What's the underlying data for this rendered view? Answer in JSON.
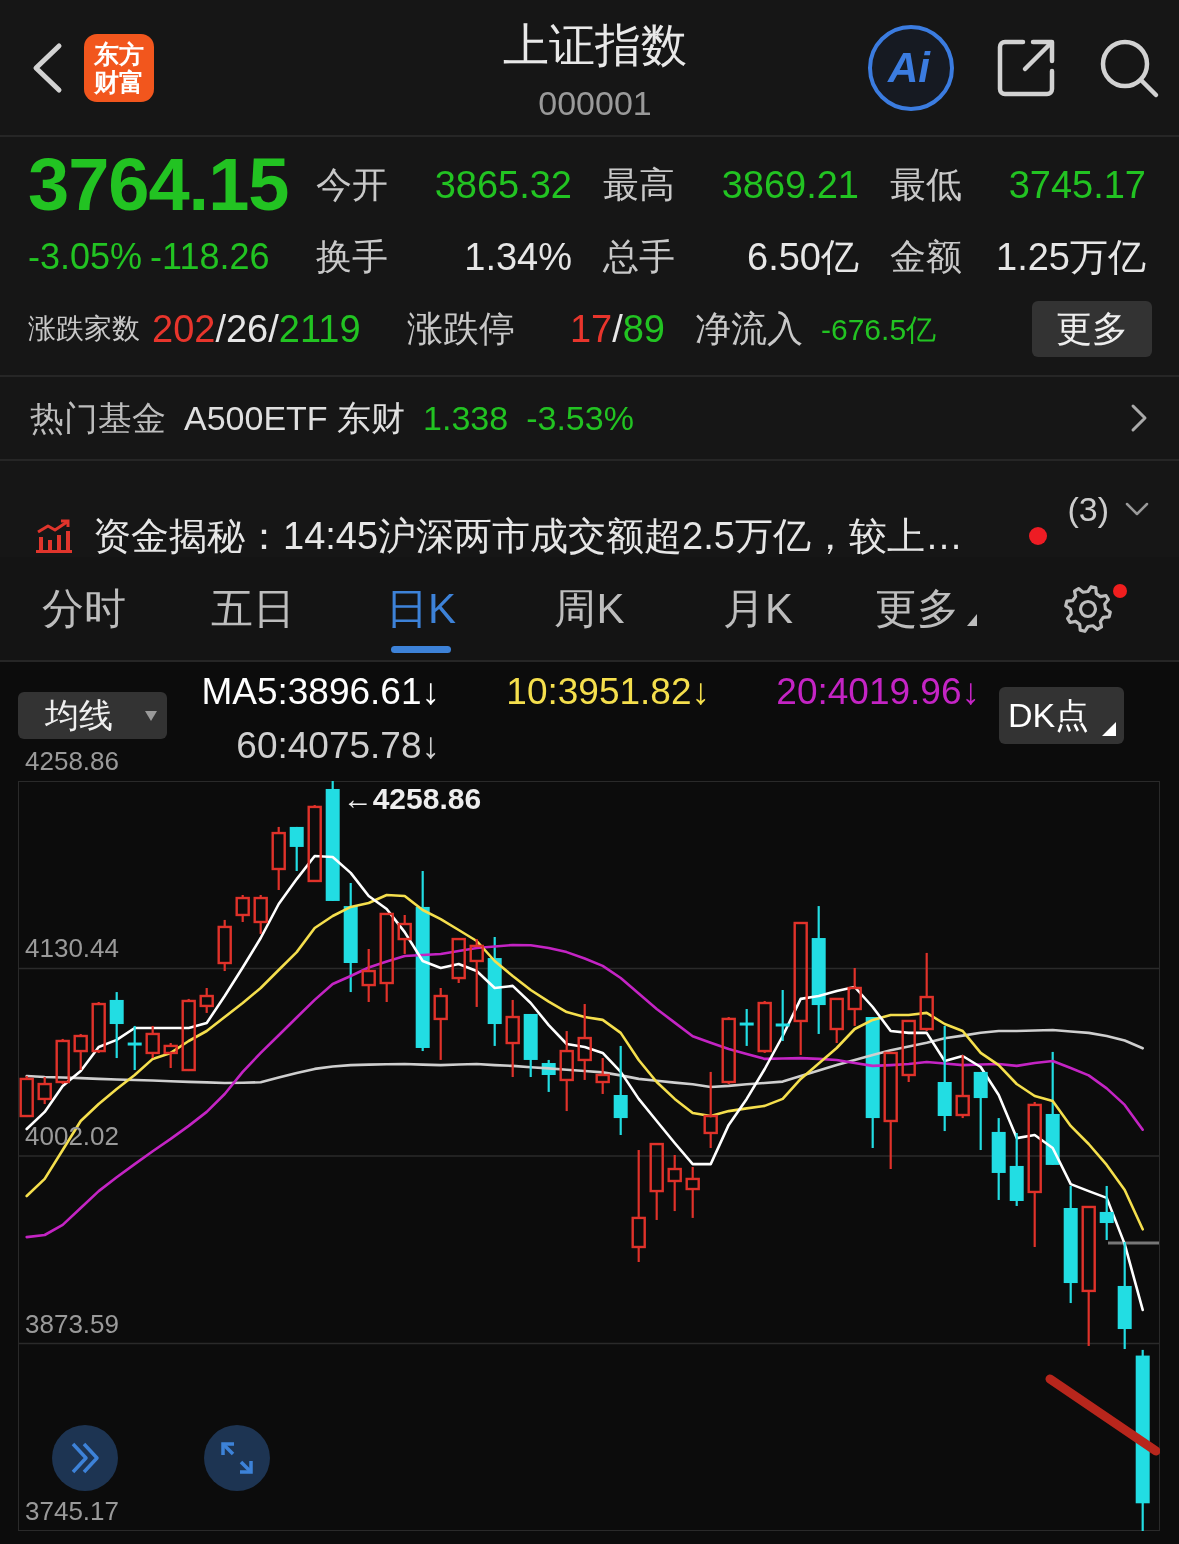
{
  "header": {
    "logo": "东方财富",
    "title": "上证指数",
    "code": "000001",
    "ai_button": "Ai"
  },
  "quote": {
    "price": "3764.15",
    "change_pct": "-3.05%",
    "change": "-118.26",
    "falling": true,
    "stats": [
      {
        "label": "今开",
        "value": "3865.32",
        "color": "#22c322"
      },
      {
        "label": "最高",
        "value": "3869.21",
        "color": "#22c322"
      },
      {
        "label": "最低",
        "value": "3745.17",
        "color": "#22c322"
      },
      {
        "label": "换手",
        "value": "1.34%",
        "color": "#e6e6e6"
      },
      {
        "label": "总手",
        "value": "6.50亿",
        "color": "#e6e6e6"
      },
      {
        "label": "金额",
        "value": "1.25万亿",
        "color": "#e6e6e6"
      }
    ],
    "breadth": {
      "label": "涨跌家数",
      "parts": [
        {
          "text": "202",
          "color": "#e8352c"
        },
        {
          "text": "/26/",
          "color": "#e6e6e6"
        },
        {
          "text": "2119",
          "color": "#22c322"
        }
      ]
    },
    "limits": {
      "label": "涨跌停",
      "parts": [
        {
          "text": "17",
          "color": "#e8352c"
        },
        {
          "text": "/",
          "color": "#e6e6e6"
        },
        {
          "text": "89",
          "color": "#22c322"
        }
      ]
    },
    "net_inflow": {
      "label": "净流入",
      "value": "-676.5亿",
      "falling": true
    },
    "more_button": "更多"
  },
  "hot_fund": {
    "label": "热门基金",
    "name": "A500ETF 东财",
    "price": "1.338",
    "change": "-3.53%",
    "falling": true
  },
  "news": {
    "text": "资金揭秘：14:45沪深两市成交额超2.5万亿，较上…",
    "unread": true,
    "count": "(3)"
  },
  "period_tabs": [
    {
      "label": "分时",
      "selected": false,
      "kind": "tab"
    },
    {
      "label": "五日",
      "selected": false,
      "kind": "tab"
    },
    {
      "label": "日K",
      "selected": true,
      "kind": "tab"
    },
    {
      "label": "周K",
      "selected": false,
      "kind": "tab"
    },
    {
      "label": "月K",
      "selected": false,
      "kind": "tab"
    },
    {
      "label": "更多",
      "selected": false,
      "kind": "menu"
    }
  ],
  "settings": {
    "badge": true
  },
  "indicators": {
    "dropdown": "均线",
    "dk_button": "DK点"
  },
  "chart": {
    "chart_data": {
      "type": "candlestick",
      "grid": true,
      "ylim": [
        3745.17,
        4258.86
      ],
      "yticks": [
        4258.86,
        4130.44,
        4002.02,
        3873.59,
        3745.17
      ],
      "ohlc": [
        [
          4029.4,
          4056.8,
          4028.7,
          4054.8
        ],
        [
          4041.1,
          4056.1,
          4037.6,
          4051.3
        ],
        [
          4052.7,
          4082.2,
          4051.3,
          4080.8
        ],
        [
          4073.9,
          4085.6,
          4060.9,
          4084.2
        ],
        [
          4073.9,
          4107.5,
          4072.6,
          4106.1
        ],
        [
          4108.9,
          4114.3,
          4069.1,
          4092.4
        ],
        [
          4079.4,
          4091.1,
          4060.9,
          4078.0
        ],
        [
          4072.6,
          4091.1,
          4069.1,
          4085.6
        ],
        [
          4072.6,
          4079.4,
          4062.3,
          4077.4
        ],
        [
          4060.9,
          4109.6,
          4060.2,
          4108.2
        ],
        [
          4104.8,
          4117.1,
          4100.0,
          4111.6
        ],
        [
          4134.2,
          4163.7,
          4128.7,
          4158.9
        ],
        [
          4167.1,
          4180.8,
          4162.3,
          4178.7
        ],
        [
          4162.3,
          4180.8,
          4154.1,
          4178.7
        ],
        [
          4198.6,
          4227.4,
          4184.2,
          4223.2
        ],
        [
          4227.4,
          4227.4,
          4197.2,
          4213.7
        ],
        [
          4190.4,
          4242.4,
          4189.7,
          4241.1
        ],
        [
          4253.4,
          4258.86,
          4176.7,
          4176.7
        ],
        [
          4173.2,
          4189.0,
          4114.3,
          4134.2
        ],
        [
          4119.1,
          4143.8,
          4107.5,
          4128.7
        ],
        [
          4120.5,
          4167.8,
          4107.5,
          4167.8
        ],
        [
          4150.6,
          4167.1,
          4140.4,
          4160.9
        ],
        [
          4172.6,
          4197.2,
          4073.9,
          4076.0
        ],
        [
          4095.9,
          4117.1,
          4067.8,
          4111.6
        ],
        [
          4123.9,
          4150.6,
          4120.5,
          4150.6
        ],
        [
          4135.6,
          4150.6,
          4104.1,
          4145.9
        ],
        [
          4137.6,
          4152.0,
          4077.4,
          4092.4
        ],
        [
          4079.4,
          4108.9,
          4056.1,
          4097.2
        ],
        [
          4099.3,
          4099.3,
          4056.1,
          4067.8
        ],
        [
          4065.7,
          4067.8,
          4045.9,
          4057.5
        ],
        [
          4054.1,
          4087.6,
          4032.8,
          4073.9
        ],
        [
          4067.8,
          4106.1,
          4054.1,
          4082.8
        ],
        [
          4052.7,
          4069.1,
          4044.5,
          4057.5
        ],
        [
          4043.8,
          4077.4,
          4016.4,
          4028.0
        ],
        [
          3939.7,
          4006.1,
          3929.4,
          3959.6
        ],
        [
          3978.0,
          4010.2,
          3958.2,
          4010.2
        ],
        [
          3984.9,
          4002.7,
          3964.3,
          3993.1
        ],
        [
          3979.4,
          3994.5,
          3959.6,
          3986.3
        ],
        [
          4017.8,
          4059.6,
          4007.5,
          4029.4
        ],
        [
          4052.7,
          4097.2,
          4051.3,
          4095.9
        ],
        [
          4093.1,
          4102.7,
          4077.4,
          4091.7
        ],
        [
          4073.9,
          4108.2,
          4072.6,
          4106.8
        ],
        [
          4092.4,
          4115.7,
          4080.8,
          4091.1
        ],
        [
          4094.5,
          4161.6,
          4071.2,
          4161.6
        ],
        [
          4151.3,
          4173.2,
          4085.6,
          4105.4
        ],
        [
          4089.0,
          4109.6,
          4079.4,
          4109.6
        ],
        [
          4102.7,
          4130.8,
          4091.1,
          4117.1
        ],
        [
          4097.2,
          4097.2,
          4007.5,
          4028.0
        ],
        [
          4026.0,
          4072.6,
          3993.1,
          4072.6
        ],
        [
          4057.5,
          4094.5,
          4052.7,
          4094.5
        ],
        [
          4089.0,
          4141.1,
          4087.6,
          4110.9
        ],
        [
          4052.7,
          4091.1,
          4019.1,
          4029.4
        ],
        [
          4030.1,
          4071.2,
          4028.0,
          4043.1
        ],
        [
          4059.6,
          4059.6,
          4006.1,
          4041.7
        ],
        [
          4018.5,
          4028.0,
          3971.9,
          3990.4
        ],
        [
          3995.2,
          4017.8,
          3967.8,
          3971.2
        ],
        [
          3977.4,
          4039.0,
          3939.7,
          4037.0
        ],
        [
          4030.8,
          4073.3,
          3995.9,
          3995.9
        ],
        [
          3966.4,
          3981.5,
          3901.3,
          3915.0
        ],
        [
          3909.6,
          3967.1,
          3871.9,
          3967.1
        ],
        [
          3963.7,
          3981.5,
          3944.5,
          3956.1
        ],
        [
          3913.0,
          3943.1,
          3869.8,
          3883.5
        ],
        [
          3865.32,
          3869.21,
          3745.17,
          3764.15
        ]
      ],
      "series": [
        {
          "name": "MA5:3896.61↓",
          "type": "line",
          "color": "#ffffff",
          "values": [
            4020.5,
            4032.2,
            4050.0,
            4060.2,
            4076.7,
            4081.5,
            4089.7,
            4089.7,
            4089.7,
            4089.7,
            4093.1,
            4111.6,
            4131.1,
            4151.3,
            4174.6,
            4191.7,
            4207.5,
            4206.8,
            4195.9,
            4180.1,
            4171.2,
            4155.4,
            4135.6,
            4130.8,
            4133.5,
            4128.7,
            4117.1,
            4118.5,
            4106.8,
            4091.7,
            4078.7,
            4076.7,
            4072.6,
            4059.6,
            4041.1,
            4026.0,
            4010.9,
            3996.5,
            3996.5,
            4023.3,
            4041.1,
            4061.6,
            4084.2,
            4109.6,
            4111.6,
            4115.0,
            4117.8,
            4104.1,
            4087.6,
            4086.3,
            4086.3,
            4067.1,
            4070.5,
            4063.0,
            4043.8,
            4014.3,
            4016.4,
            4007.5,
            3982.8,
            3978.0,
            3973.3,
            3941.7,
            3896.6
          ]
        },
        {
          "name": "10:3951.82↓",
          "type": "line",
          "color": "#f5df4d",
          "values": [
            3974.6,
            3986.3,
            4006.1,
            4026.0,
            4037.6,
            4047.9,
            4057.5,
            4068.5,
            4072.6,
            4080.8,
            4087.6,
            4097.2,
            4106.8,
            4117.1,
            4129.4,
            4141.7,
            4158.2,
            4166.4,
            4172.6,
            4175.3,
            4180.8,
            4180.1,
            4170.5,
            4164.3,
            4156.8,
            4149.3,
            4135.6,
            4125.3,
            4115.7,
            4107.8,
            4100.6,
            4097.2,
            4095.2,
            4086.3,
            4067.8,
            4052.7,
            4041.1,
            4031.5,
            4029.4,
            4032.8,
            4034.6,
            4036.3,
            4041.1,
            4054.8,
            4065.4,
            4076.0,
            4089.0,
            4095.2,
            4098.6,
            4098.6,
            4100.0,
            4092.4,
            4087.6,
            4072.6,
            4064.3,
            4051.3,
            4043.1,
            4039.7,
            4022.6,
            4010.2,
            3995.9,
            3978.7,
            3951.8
          ]
        },
        {
          "name": "20:4019.96↓",
          "type": "line",
          "color": "#c424c4",
          "values": [
            3946.5,
            3947.9,
            3954.8,
            3966.4,
            3978.0,
            3987.4,
            3996.5,
            4005.3,
            4013.7,
            4022.6,
            4032.2,
            4044.5,
            4059.6,
            4072.6,
            4084.7,
            4096.9,
            4108.9,
            4119.8,
            4125.3,
            4131.1,
            4135.3,
            4139.0,
            4139.7,
            4140.4,
            4142.4,
            4144.5,
            4145.5,
            4146.5,
            4146.3,
            4144.5,
            4141.7,
            4137.3,
            4132.2,
            4123.9,
            4113.3,
            4102.7,
            4093.4,
            4084.1,
            4079.6,
            4075.3,
            4071.9,
            4068.5,
            4068.8,
            4069.1,
            4068.5,
            4067.8,
            4065.7,
            4063.7,
            4064.3,
            4065.0,
            4066.4,
            4065.4,
            4064.3,
            4064.7,
            4065.0,
            4063.7,
            4065.7,
            4067.1,
            4062.3,
            4057.2,
            4048.3,
            4037.0,
            4020.0
          ]
        },
        {
          "name": "60:4075.78↓",
          "type": "line",
          "color": "#cfcfcf",
          "values": [
            4056.8,
            4056.1,
            4055.8,
            4055.4,
            4054.8,
            4054.4,
            4054.1,
            4053.7,
            4053.2,
            4052.8,
            4052.4,
            4052.0,
            4052.2,
            4052.5,
            4055.8,
            4058.9,
            4061.7,
            4063.3,
            4064.3,
            4064.6,
            4064.8,
            4065.0,
            4064.6,
            4064.3,
            4064.7,
            4065.0,
            4064.3,
            4063.7,
            4062.8,
            4062.0,
            4061.1,
            4060.2,
            4059.3,
            4057.2,
            4054.8,
            4053.5,
            4052.3,
            4051.1,
            4049.3,
            4050.0,
            4051.1,
            4052.0,
            4053.0,
            4056.8,
            4060.6,
            4064.3,
            4067.8,
            4071.2,
            4074.5,
            4077.0,
            4079.6,
            4082.7,
            4084.5,
            4086.4,
            4087.6,
            4087.6,
            4088.0,
            4088.3,
            4087.3,
            4086.3,
            4084.2,
            4081.1,
            4075.8
          ]
        }
      ],
      "annotations": [
        "←4258.86"
      ]
    }
  }
}
